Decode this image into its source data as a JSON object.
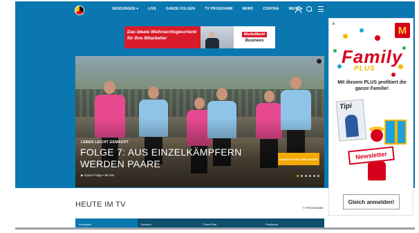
{
  "nav": {
    "items": [
      "SENDUNGEN ▾",
      "LIVE",
      "GANZE FOLGEN",
      "TV PROGRAMM",
      "NEWS",
      "CORONA",
      "MEHR ▾"
    ]
  },
  "banner": {
    "headline": "Das ideale Weihnachtsgeschenk für Ihre Mitarbeiter",
    "brand": "MediaMarkt",
    "brand_sub": "Business"
  },
  "hero": {
    "kicker": "LEBEN LEICHT GEMACHT",
    "title": "FOLGE 7: AUS EINZELKÄMPFERN WERDEN PAARE",
    "meta": "▶ Ganze Folge • 90 min",
    "cta": "GANZE FOLGE ANSCHAUEN",
    "slides": 6,
    "active_slide": 1
  },
  "section": {
    "heading": "HEUTE IM TV",
    "link": "TV PROGRAMM",
    "tabs": [
      "Leuchtzeit",
      "Deutsch",
      "PrimeTime",
      "Prosieben"
    ]
  },
  "side_ad": {
    "close": "×",
    "logo_letter": "M",
    "title": "Family",
    "subtitle": "PLUS",
    "copy": "Mit diesem PLUS profitiert die ganze Familie!",
    "magazine": "Tipi",
    "newsletter": "Newsletter",
    "cta": "Gleich anmelden!"
  },
  "colors": {
    "brand_blue": "#0a77b0",
    "accent_yellow": "#f2a900",
    "ad_red": "#d6001c"
  }
}
